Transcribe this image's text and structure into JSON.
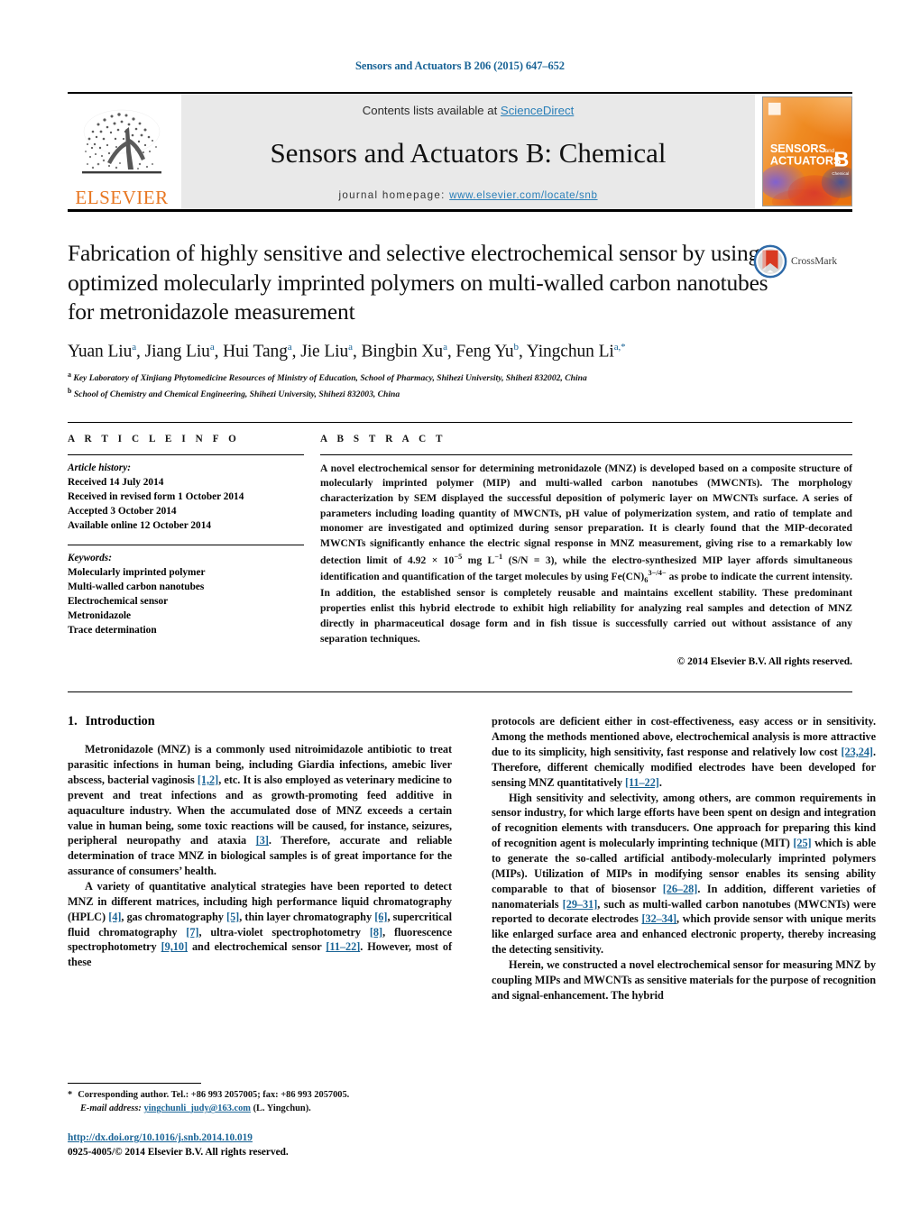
{
  "running_head": "Sensors and Actuators B 206 (2015) 647–652",
  "header": {
    "contents_prefix": "Contents lists available at ",
    "sciencedirect": "ScienceDirect",
    "journal_title": "Sensors and Actuators B: Chemical",
    "homepage_prefix": "journal homepage:",
    "homepage_url": "www.elsevier.com/locate/snb",
    "publisher": "ELSEVIER",
    "cover_line1": "SENSORS",
    "cover_and": "and",
    "cover_line2": "ACTUATORS",
    "cover_letter": "B",
    "cover_sub": "Chemical",
    "accent_orange": "#E87722",
    "accent_blue": "#2a7fb8",
    "link_blue": "#1a6496"
  },
  "title": "Fabrication of highly sensitive and selective electrochemical sensor by using optimized molecularly imprinted polymers on multi-walled carbon nanotubes for metronidazole measurement",
  "crossmark_label": "CrossMark",
  "authors": [
    {
      "name": "Yuan Liu",
      "sup": "a"
    },
    {
      "name": "Jiang Liu",
      "sup": "a"
    },
    {
      "name": "Hui Tang",
      "sup": "a"
    },
    {
      "name": "Jie Liu",
      "sup": "a"
    },
    {
      "name": "Bingbin Xu",
      "sup": "a"
    },
    {
      "name": "Feng Yu",
      "sup": "b"
    },
    {
      "name": "Yingchun Li",
      "sup": "a,*"
    }
  ],
  "affiliations": [
    {
      "marker": "a",
      "text": "Key Laboratory of Xinjiang Phytomedicine Resources of Ministry of Education, School of Pharmacy, Shihezi University, Shihezi 832002, China"
    },
    {
      "marker": "b",
      "text": "School of Chemistry and Chemical Engineering, Shihezi University, Shihezi 832003, China"
    }
  ],
  "article_info": {
    "heading": "A R T I C L E   I N F O",
    "history_title": "Article history:",
    "history": [
      "Received 14 July 2014",
      "Received in revised form 1 October 2014",
      "Accepted 3 October 2014",
      "Available online 12 October 2014"
    ],
    "keywords_title": "Keywords:",
    "keywords": [
      "Molecularly imprinted polymer",
      "Multi-walled carbon nanotubes",
      "Electrochemical sensor",
      "Metronidazole",
      "Trace determination"
    ]
  },
  "abstract": {
    "heading": "A B S T R A C T",
    "part1": "A novel electrochemical sensor for determining metronidazole (MNZ) is developed based on a composite structure of molecularly imprinted polymer (MIP) and multi-walled carbon nanotubes (MWCNTs). The morphology characterization by SEM displayed the successful deposition of polymeric layer on MWCNTs surface. A series of parameters including loading quantity of MWCNTs, pH value of polymerization system, and ratio of template and monomer are investigated and optimized during sensor preparation. It is clearly found that the MIP-decorated MWCNTs significantly enhance the electric signal response in MNZ measurement, giving rise to a remarkably low detection limit of 4.92 × 10",
    "sup1": "−5",
    "part2": " mg L",
    "sup2": "−1",
    "part3": " (S/N = 3), while the electro-synthesized MIP layer affords simultaneous identification and quantification of the target molecules by using Fe(CN)",
    "sub1": "6",
    "sup3": "3−/4−",
    "part4": " as probe to indicate the current intensity. In addition, the established sensor is completely reusable and maintains excellent stability. These predominant properties enlist this hybrid electrode to exhibit high reliability for analyzing real samples and detection of MNZ directly in pharmaceutical dosage form and in fish tissue is successfully carried out without assistance of any separation techniques.",
    "copyright": "© 2014 Elsevier B.V. All rights reserved."
  },
  "body": {
    "section_number": "1.",
    "section_title": "Introduction",
    "left_paragraphs": [
      {
        "segments": [
          {
            "t": "Metronidazole (MNZ) is a commonly used nitroimidazole antibiotic to treat parasitic infections in human being, including Giardia infections, amebic liver abscess, bacterial vaginosis "
          },
          {
            "t": "[1,2]",
            "ref": true
          },
          {
            "t": ", etc. It is also employed as veterinary medicine to prevent and treat infections and as growth-promoting feed additive in aquaculture industry. When the accumulated dose of MNZ exceeds a certain value in human being, some toxic reactions will be caused, for instance, seizures, peripheral neuropathy and ataxia "
          },
          {
            "t": "[3]",
            "ref": true
          },
          {
            "t": ". Therefore, accurate and reliable determination of trace MNZ in biological samples is of great importance for the assurance of consumers’ health."
          }
        ]
      },
      {
        "segments": [
          {
            "t": "A variety of quantitative analytical strategies have been reported to detect MNZ in different matrices, including high performance liquid chromatography (HPLC) "
          },
          {
            "t": "[4]",
            "ref": true
          },
          {
            "t": ", gas chromatography "
          },
          {
            "t": "[5]",
            "ref": true
          },
          {
            "t": ", thin layer chromatography "
          },
          {
            "t": "[6]",
            "ref": true
          },
          {
            "t": ", supercritical fluid chromatography "
          },
          {
            "t": "[7]",
            "ref": true
          },
          {
            "t": ", ultra-violet spectrophotometry "
          },
          {
            "t": "[8]",
            "ref": true
          },
          {
            "t": ", fluorescence spectrophotometry "
          },
          {
            "t": "[9,10]",
            "ref": true
          },
          {
            "t": " and electrochemical sensor "
          },
          {
            "t": "[11–22]",
            "ref": true
          },
          {
            "t": ". However, most of these"
          }
        ]
      }
    ],
    "right_paragraphs": [
      {
        "continuation": true,
        "segments": [
          {
            "t": "protocols are deficient either in cost-effectiveness, easy access or in sensitivity. Among the methods mentioned above, electrochemical analysis is more attractive due to its simplicity, high sensitivity, fast response and relatively low cost "
          },
          {
            "t": "[23,24]",
            "ref": true
          },
          {
            "t": ". Therefore, different chemically modified electrodes have been developed for sensing MNZ quantitatively "
          },
          {
            "t": "[11–22]",
            "ref": true
          },
          {
            "t": "."
          }
        ]
      },
      {
        "segments": [
          {
            "t": "High sensitivity and selectivity, among others, are common requirements in sensor industry, for which large efforts have been spent on design and integration of recognition elements with transducers. One approach for preparing this kind of recognition agent is molecularly imprinting technique (MIT) "
          },
          {
            "t": "[25]",
            "ref": true
          },
          {
            "t": " which is able to generate the so-called artificial antibody-molecularly imprinted polymers (MIPs). Utilization of MIPs in modifying sensor enables its sensing ability comparable to that of biosensor "
          },
          {
            "t": "[26–28]",
            "ref": true
          },
          {
            "t": ". In addition, different varieties of nanomaterials "
          },
          {
            "t": "[29–31]",
            "ref": true
          },
          {
            "t": ", such as multi-walled carbon nanotubes (MWCNTs) were reported to decorate electrodes "
          },
          {
            "t": "[32–34]",
            "ref": true
          },
          {
            "t": ", which provide sensor with unique merits like enlarged surface area and enhanced electronic property, thereby increasing the detecting sensitivity."
          }
        ]
      },
      {
        "segments": [
          {
            "t": "Herein, we constructed a novel electrochemical sensor for measuring MNZ by coupling MIPs and MWCNTs as sensitive materials for the purpose of recognition and signal-enhancement. The hybrid"
          }
        ]
      }
    ]
  },
  "footer": {
    "star": "*",
    "corresponding": "Corresponding author. Tel.: +86 993 2057005; fax: +86 993 2057005.",
    "email_label": "E-mail address:",
    "email": "yingchunli_judy@163.com",
    "email_suffix": "(L. Yingchun).",
    "doi": "http://dx.doi.org/10.1016/j.snb.2014.10.019",
    "issn_line": "0925-4005/© 2014 Elsevier B.V. All rights reserved."
  }
}
